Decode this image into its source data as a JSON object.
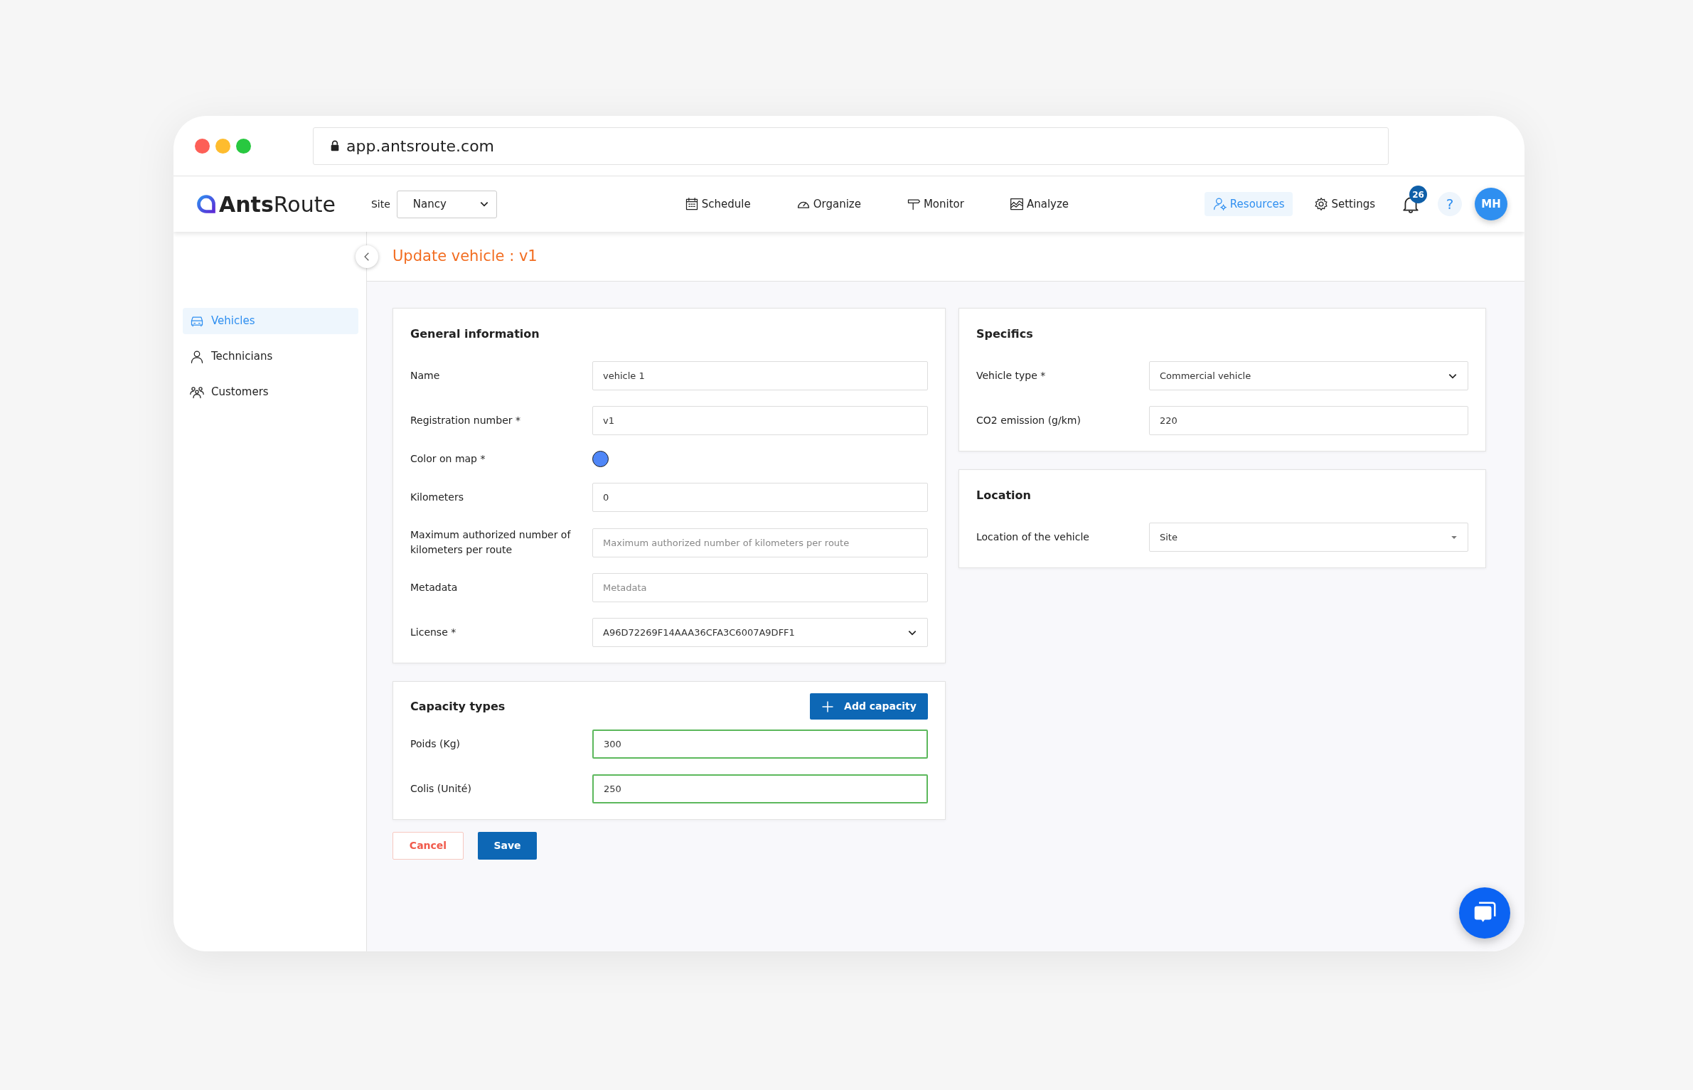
{
  "browser": {
    "url": "app.antsroute.com"
  },
  "app_bar": {
    "logo": {
      "bold": "Ants",
      "light": "Route"
    },
    "site": {
      "label": "Site",
      "value": "Nancy"
    },
    "nav": [
      {
        "label": "Schedule",
        "kind": "calendar",
        "selected": false
      },
      {
        "label": "Organize",
        "kind": "gauge",
        "selected": false
      },
      {
        "label": "Monitor",
        "kind": "signpost",
        "selected": false
      },
      {
        "label": "Analyze",
        "kind": "chart",
        "selected": false
      }
    ],
    "nav_right": [
      {
        "label": "Resources",
        "kind": "people",
        "selected": true
      },
      {
        "label": "Settings",
        "kind": "gear",
        "selected": false
      }
    ],
    "notifications": "26",
    "help": "?",
    "avatar": "MH"
  },
  "sidebar": {
    "items": [
      {
        "label": "Vehicles",
        "kind": "car",
        "selected": true
      },
      {
        "label": "Technicians",
        "kind": "person",
        "selected": false
      },
      {
        "label": "Customers",
        "kind": "group",
        "selected": false
      }
    ]
  },
  "page_title": "Update vehicle : v1",
  "general_information": {
    "title": "General information",
    "fields": [
      {
        "label": "Name",
        "kind": "text",
        "value": "vehicle 1"
      },
      {
        "label": "Registration number *",
        "kind": "text",
        "value": "v1"
      },
      {
        "label": "Color on map *",
        "kind": "color",
        "color": "#4f86f7"
      },
      {
        "label": "Kilometers",
        "kind": "text",
        "value": "0"
      },
      {
        "label": "Maximum authorized number of kilometers per route",
        "kind": "text",
        "placeholder": "Maximum authorized number of kilometers per route"
      },
      {
        "label": "Metadata",
        "kind": "text",
        "placeholder": "Metadata"
      },
      {
        "label": "License *",
        "kind": "select",
        "value": "A96D72269F14AAA36CFA3C6007A9DFF1"
      }
    ]
  },
  "capacity_types": {
    "title": "Capacity types",
    "add_button": "Add capacity",
    "fields": [
      {
        "label": "Poids (Kg)",
        "kind": "text",
        "value": "300",
        "valid": true
      },
      {
        "label": "Colis (Unité)",
        "kind": "text",
        "value": "250",
        "valid": true
      }
    ]
  },
  "specifics": {
    "title": "Specifics",
    "fields": [
      {
        "label": "Vehicle type *",
        "kind": "select",
        "value": "Commercial vehicle"
      },
      {
        "label": "CO2 emission (g/km)",
        "kind": "text",
        "value": "220"
      }
    ]
  },
  "location": {
    "title": "Location",
    "fields": [
      {
        "label": "Location of the vehicle",
        "kind": "dropdown",
        "value": "Site"
      }
    ]
  },
  "actions": {
    "cancel": "Cancel",
    "save": "Save"
  }
}
